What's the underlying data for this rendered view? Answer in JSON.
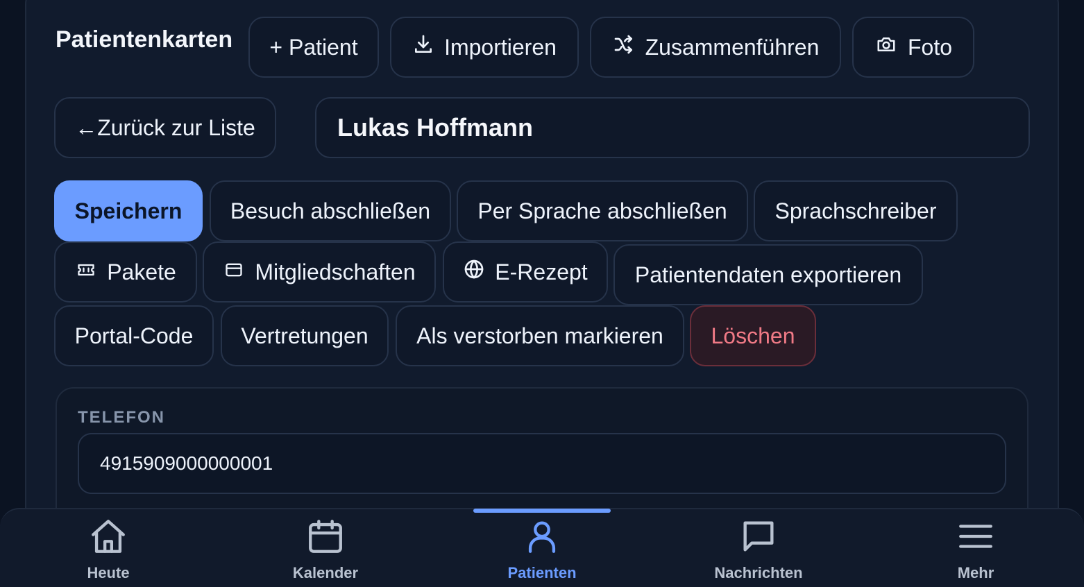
{
  "header": {
    "title": "Patientenkarten",
    "actions": {
      "add_patient": "+ Patient",
      "import": "Importieren",
      "merge": "Zusammenführen",
      "photo": "Foto"
    }
  },
  "patient": {
    "back_label": "←Zurück zur Liste",
    "name": "Lukas Hoffmann"
  },
  "actions": {
    "save": "Speichern",
    "close_visit": "Besuch abschließen",
    "close_by_voice": "Per Sprache abschließen",
    "voice_writer": "Sprachschreiber",
    "packages": "Pakete",
    "memberships": "Mitgliedschaften",
    "erezept": "E-Rezept",
    "export_data": "Patientendaten exportieren",
    "portal_code": "Portal-Code",
    "substitutions": "Vertretungen",
    "mark_deceased": "Als verstorben markieren",
    "delete": "Löschen"
  },
  "fields": {
    "phone_label": "TELEFON",
    "phone_value": "4915909000000001"
  },
  "nav": {
    "items": [
      {
        "label": "Heute",
        "icon": "home-icon"
      },
      {
        "label": "Kalender",
        "icon": "calendar-icon"
      },
      {
        "label": "Patienten",
        "icon": "user-icon",
        "active": true
      },
      {
        "label": "Nachrichten",
        "icon": "message-icon"
      },
      {
        "label": "Mehr",
        "icon": "menu-icon"
      }
    ]
  },
  "colors": {
    "accent": "#6b9cff",
    "danger": "#f07a86",
    "background": "#0b1322"
  }
}
